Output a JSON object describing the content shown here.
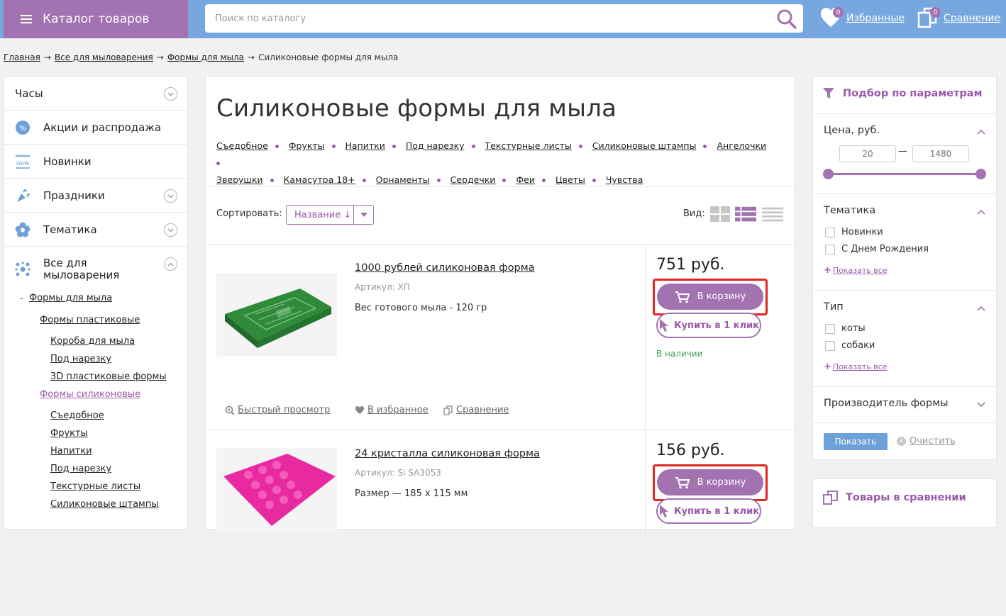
{
  "header": {
    "catalog_label": "Каталог товаров",
    "search_placeholder": "Поиск по каталогу",
    "favorites_label": "Избранные",
    "favorites_count": "0",
    "compare_label": "Сравнение",
    "compare_count": "0"
  },
  "breadcrumb": {
    "items": [
      "Главная",
      "Все для мыловарения",
      "Формы для мыла"
    ],
    "current": "Силиконовые формы для мыла",
    "separator": "→"
  },
  "sidebar": {
    "items": [
      {
        "label": "Часы",
        "icon": "none"
      },
      {
        "label": "Акции и распродажа",
        "icon": "percent-icon"
      },
      {
        "label": "Новинки",
        "icon": "new-icon"
      },
      {
        "label": "Праздники",
        "icon": "confetti-icon"
      },
      {
        "label": "Тематика",
        "icon": "flower-icon"
      },
      {
        "label": "Все для\nмыловарения",
        "icon": "molecule-icon"
      }
    ],
    "sub": {
      "forms_soap": "Формы для мыла",
      "forms_plastic": "Формы пластиковые",
      "boxes": "Короба для мыла",
      "cut": "Под нарезку",
      "plastic3d": "3D пластиковые формы",
      "forms_silicone": "Формы силиконовые",
      "edible": "Съедобное",
      "fruits": "Фрукты",
      "drinks": "Напитки",
      "cut2": "Под нарезку",
      "texture": "Текстурные листы",
      "stamps": "Силиконовые штампы"
    }
  },
  "main": {
    "title": "Силиконовые формы для мыла",
    "tags": [
      "Съедобное",
      "Фрукты",
      "Напитки",
      "Под нарезку",
      "Текстурные листы",
      "Силиконовые штампы",
      "Ангелочки",
      "Зверушки",
      "Камасутра 18+",
      "Орнаменты",
      "Сердечки",
      "Феи",
      "Цветы",
      "Чувства"
    ],
    "sort_label": "Сортировать:",
    "sort_value": "Название ↓",
    "view_label": "Вид:",
    "products": [
      {
        "name": "1000 рублей силиконовая форма",
        "sku": "Артикул: ХП",
        "desc": "Вес готового мыла - 120 гр",
        "price": "751 руб.",
        "cart_label": "В корзину",
        "oneclick_label": "Купить в 1 клик",
        "stock": "В наличии",
        "quick_view": "Быстрый просмотр",
        "favorite": "В избранное",
        "compare": "Сравнение"
      },
      {
        "name": "24 кристалла силиконовая форма",
        "sku": "Артикул: Si SA3053",
        "desc": "Размер — 185 х 115 мм",
        "price": "156 руб.",
        "cart_label": "В корзину",
        "oneclick_label": "Купить в 1 клик"
      }
    ]
  },
  "filter": {
    "title": "Подбор по параметрам",
    "price_title": "Цена, руб.",
    "price_min": "20",
    "price_max": "1480",
    "price_dash": "—",
    "theme_title": "Тематика",
    "theme_options": [
      "Новинки",
      "С Днем Рождения"
    ],
    "show_all": "Показать все",
    "type_title": "Тип",
    "type_options": [
      "коты",
      "собаки"
    ],
    "maker_title": "Производитель формы",
    "show_btn": "Показать",
    "clear_btn": "Очистить"
  },
  "compare_box": {
    "title": "Товары в сравнении"
  },
  "colors": {
    "header_blue": "#76a8df",
    "brand_purple": "#a372b0",
    "highlight_red": "#e0261f",
    "stock_green": "#3e9f4a"
  }
}
